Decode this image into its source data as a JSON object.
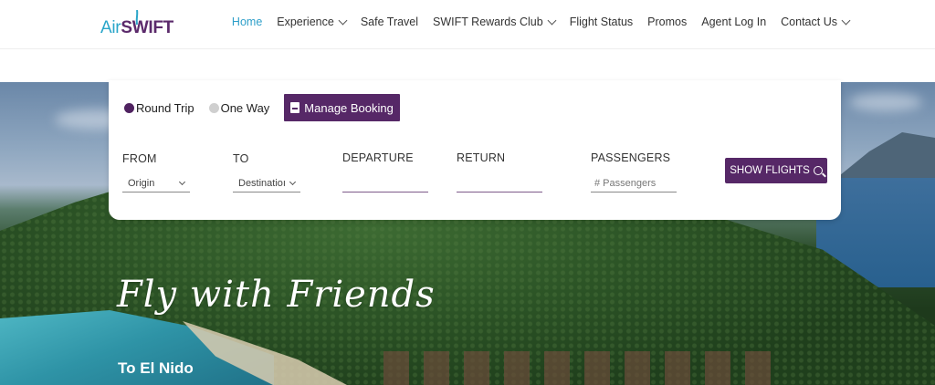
{
  "brand": {
    "part1": "Air",
    "part2": "SWIFT"
  },
  "nav": {
    "items": [
      {
        "label": "Home",
        "active": true,
        "dropdown": false
      },
      {
        "label": "Experience",
        "active": false,
        "dropdown": true
      },
      {
        "label": "Safe Travel",
        "active": false,
        "dropdown": false
      },
      {
        "label": "SWIFT Rewards Club",
        "active": false,
        "dropdown": true
      },
      {
        "label": "Flight Status",
        "active": false,
        "dropdown": false
      },
      {
        "label": "Promos",
        "active": false,
        "dropdown": false
      },
      {
        "label": "Agent Log In",
        "active": false,
        "dropdown": false
      },
      {
        "label": "Contact Us",
        "active": false,
        "dropdown": true
      }
    ]
  },
  "booking": {
    "trip_types": {
      "round_trip": "Round Trip",
      "one_way": "One Way",
      "selected": "Round Trip"
    },
    "manage_label": "Manage Booking",
    "from_label": "FROM",
    "from_value": "Origin",
    "to_label": "TO",
    "to_value": "Destinatioı",
    "departure_label": "DEPARTURE",
    "return_label": "RETURN",
    "passengers_label": "PASSENGERS",
    "passengers_placeholder": "# Passengers",
    "show_label": "SHOW FLIGHTS"
  },
  "hero": {
    "title": "Fly with Friends",
    "subtitle": "To El Nido"
  },
  "colors": {
    "brand_purple": "#562867",
    "nav_active": "#2e9fc9",
    "logo_teal": "#2aa6c9"
  }
}
